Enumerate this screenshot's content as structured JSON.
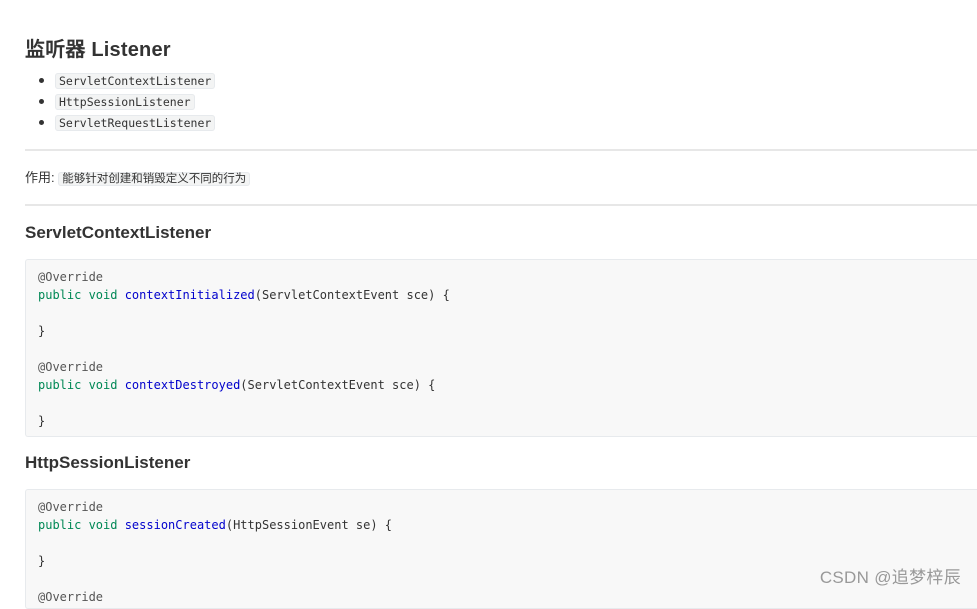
{
  "heading": "监听器 Listener",
  "listeners": [
    "ServletContextListener",
    "HttpSessionListener",
    "ServletRequestListener"
  ],
  "purpose": {
    "label": "作用:",
    "text": "能够针对创建和销毁定义不同的行为"
  },
  "sections": [
    {
      "title": "ServletContextListener",
      "code": [
        {
          "annotation": "@Override"
        },
        {
          "kw": "public void ",
          "fn": "contextInitialized",
          "rest": "(ServletContextEvent sce) {"
        },
        {
          "text": ""
        },
        {
          "text": "}"
        },
        {
          "text": ""
        },
        {
          "annotation": "@Override"
        },
        {
          "kw": "public void ",
          "fn": "contextDestroyed",
          "rest": "(ServletContextEvent sce) {"
        },
        {
          "text": ""
        },
        {
          "text": "}"
        }
      ]
    },
    {
      "title": "HttpSessionListener",
      "code": [
        {
          "annotation": "@Override"
        },
        {
          "kw": "public void ",
          "fn": "sessionCreated",
          "rest": "(HttpSessionEvent se) {"
        },
        {
          "text": ""
        },
        {
          "text": "}"
        },
        {
          "text": ""
        },
        {
          "annotation": "@Override"
        }
      ]
    }
  ],
  "watermark": "CSDN @追梦梓辰"
}
